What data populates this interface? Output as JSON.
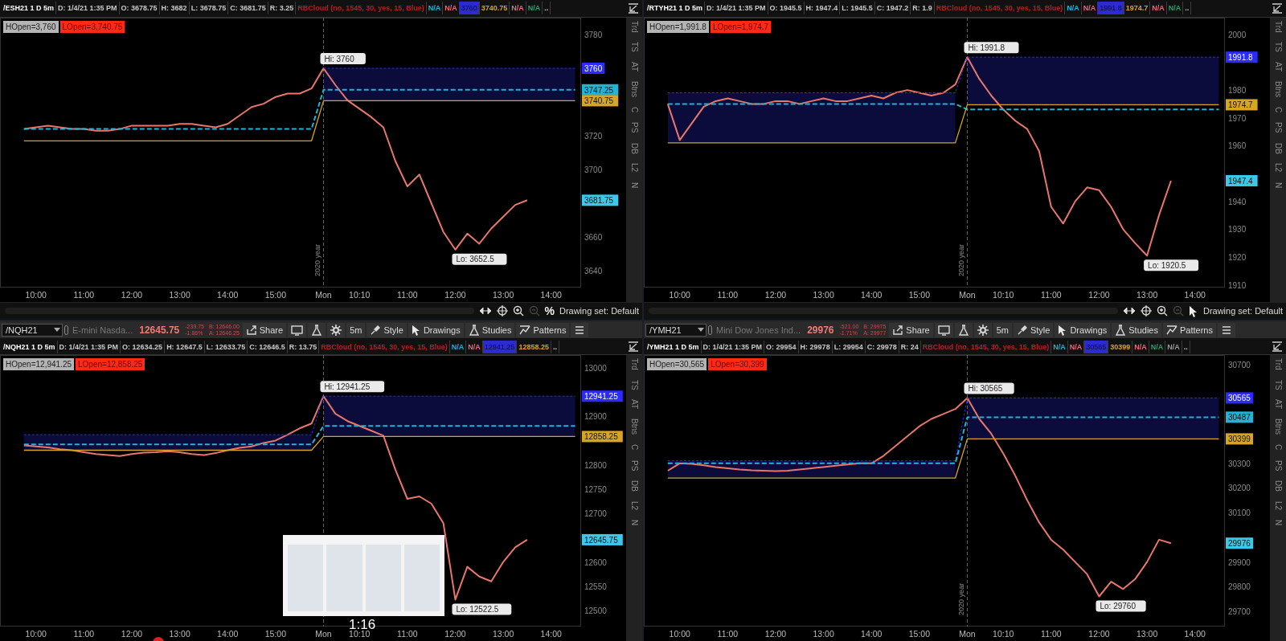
{
  "panels": [
    {
      "header_items": [
        {
          "text": "/ESH21 1 D 5m",
          "color": "#ffffff",
          "kind": "symbol"
        },
        {
          "text": "D: 1/4/21 1:35 PM",
          "color": "#c8c8c8",
          "kind": "plain"
        },
        {
          "text": "O: 3678.75",
          "color": "#c8c8c8",
          "kind": "plain"
        },
        {
          "text": "H: 3682",
          "color": "#c8c8c8",
          "kind": "plain"
        },
        {
          "text": "L: 3678.75",
          "color": "#c8c8c8",
          "kind": "plain"
        },
        {
          "text": "C: 3681.75",
          "color": "#c8c8c8",
          "kind": "plain"
        },
        {
          "text": "R: 3.25",
          "color": "#c8c8c8",
          "kind": "plain"
        },
        {
          "text": "RBCloud (no, 1545, 30, yes, 15, Blue)",
          "color": "#b02020",
          "kind": "plain"
        },
        {
          "text": "N/A",
          "color": "#1fb4d8",
          "kind": "plain"
        },
        {
          "text": "N/A",
          "color": "#e06c7c",
          "kind": "plain"
        },
        {
          "text": "3760",
          "color": "#2b2bd0",
          "kind": "boxed"
        },
        {
          "text": "3740.75",
          "color": "#d8a521",
          "kind": "plain"
        },
        {
          "text": "N/A",
          "color": "#e06c7c",
          "kind": "plain"
        },
        {
          "text": "N/A",
          "color": "#2e9e6e",
          "kind": "plain"
        },
        {
          "text": "..",
          "kind": "plain"
        }
      ],
      "study_labels": [
        {
          "text": "HOpen=3,760",
          "color": "#b4b4b4"
        },
        {
          "text": "LOpen=3,740.75",
          "color": "#ff2a14"
        }
      ],
      "side_tabs": [
        "Trd",
        "TS",
        "AT",
        "Btns",
        "C",
        "PS",
        "DB",
        "L2",
        "N"
      ],
      "chart_data": {
        "type": "line",
        "ylim": [
          3630,
          3790
        ],
        "categories": [
          null,
          "10:00",
          null,
          null,
          null,
          "11:00",
          null,
          null,
          null,
          "12:00",
          null,
          null,
          null,
          "13:00",
          null,
          null,
          null,
          "14:00",
          null,
          null,
          null,
          "15:00",
          null,
          null,
          null,
          "Mon",
          null,
          null,
          "10:10",
          null,
          null,
          null,
          "11:00",
          null,
          null,
          null,
          "12:00",
          null,
          null,
          null,
          "13:00",
          null,
          null,
          null,
          "14:00",
          null,
          null
        ],
        "series": [
          {
            "color": "#e9766b",
            "values": [
              3724,
              3725,
              3726,
              3725,
              3724,
              3724,
              3723,
              3723,
              3724,
              3726,
              3726,
              3726,
              3726,
              3727,
              3727,
              3726,
              3725,
              3727,
              3732,
              3737,
              3739,
              3743,
              3745,
              3745,
              3748,
              3760,
              3750,
              3741,
              3736,
              3731,
              3725,
              3705,
              3690,
              3697,
              3680,
              3663,
              3652.5,
              3662,
              3656,
              3665,
              3672,
              3679,
              3681.75,
              null,
              null,
              null,
              null
            ]
          },
          {
            "color": "#2b2bff",
            "line_style": "dashed",
            "values": [
              null,
              null,
              null,
              null,
              null,
              null,
              null,
              null,
              null,
              null,
              null,
              null,
              null,
              null,
              null,
              null,
              null,
              null,
              null,
              null,
              null,
              null,
              null,
              null,
              null,
              3760,
              3760,
              3760,
              3760,
              3760,
              3760,
              3760,
              3760,
              3760,
              3760,
              3760,
              3760,
              3760,
              3760,
              3760,
              3760,
              3760,
              3760,
              3760,
              3760,
              3760,
              3760
            ]
          },
          {
            "color": "#1fb4d8",
            "line_style": "dashed",
            "values": [
              3724,
              3724,
              3724,
              3724,
              3724,
              3724,
              3724,
              3724,
              3724,
              3724,
              3724,
              3724,
              3724,
              3724,
              3724,
              3724,
              3724,
              3724,
              3724,
              3724,
              3724,
              3724,
              3724,
              3724,
              3724,
              3747.25,
              3747.25,
              3747.25,
              3747.25,
              3747.25,
              3747.25,
              3747.25,
              3747.25,
              3747.25,
              3747.25,
              3747.25,
              3747.25,
              3747.25,
              3747.25,
              3747.25,
              3747.25,
              3747.25,
              3747.25,
              3747.25,
              3747.25,
              3747.25,
              3747.25
            ]
          },
          {
            "color": "#d8a521",
            "values": [
              3717,
              3717,
              3717,
              3717,
              3717,
              3717,
              3717,
              3717,
              3717,
              3717,
              3717,
              3717,
              3717,
              3717,
              3717,
              3717,
              3717,
              3717,
              3717,
              3717,
              3717,
              3717,
              3717,
              3717,
              3717,
              3740.75,
              3740.75,
              3740.75,
              3740.75,
              3740.75,
              3740.75,
              3740.75,
              3740.75,
              3740.75,
              3740.75,
              3740.75,
              3740.75,
              3740.75,
              3740.75,
              3740.75,
              3740.75,
              3740.75,
              3740.75,
              3740.75,
              3740.75,
              3740.75,
              3740.75
            ]
          }
        ],
        "yticks": [
          3780,
          3720,
          3700,
          3660,
          3640
        ],
        "annotations": [
          {
            "text": "Hi: 3760",
            "x": "Mon",
            "y": 3760
          },
          "Lo: 3652.5"
        ]
      },
      "axis_tags": [
        {
          "text": "3760",
          "color": "#2b2bff"
        },
        {
          "text": "3747.25",
          "color": "#1fb4d8"
        },
        {
          "text": "3740.75",
          "color": "#d8a521"
        },
        {
          "text": "3681.75",
          "color": "#3cc8e8"
        }
      ],
      "year_label": "2020 year",
      "status_bar": {
        "mode": {
          "kind": "text",
          "text": "%"
        },
        "text": "Drawing set: Default"
      }
    },
    {
      "header_items": [
        {
          "text": "/RTYH21 1 D 5m",
          "color": "#ffffff",
          "kind": "symbol"
        },
        {
          "text": "D: 1/4/21 1:35 PM",
          "color": "#c8c8c8",
          "kind": "plain"
        },
        {
          "text": "O: 1945.5",
          "color": "#c8c8c8",
          "kind": "plain"
        },
        {
          "text": "H: 1947.4",
          "color": "#c8c8c8",
          "kind": "plain"
        },
        {
          "text": "L: 1945.5",
          "color": "#c8c8c8",
          "kind": "plain"
        },
        {
          "text": "C: 1947.2",
          "color": "#c8c8c8",
          "kind": "plain"
        },
        {
          "text": "R: 1.9",
          "color": "#c8c8c8",
          "kind": "plain"
        },
        {
          "text": "RBCloud (no, 1545, 30, yes, 15, Blue)",
          "color": "#b02020",
          "kind": "plain"
        },
        {
          "text": "N/A",
          "color": "#1fb4d8",
          "kind": "plain"
        },
        {
          "text": "N/A",
          "color": "#e06c7c",
          "kind": "plain"
        },
        {
          "text": "1991.8",
          "color": "#2b2bd0",
          "kind": "boxed"
        },
        {
          "text": "1974.7",
          "color": "#d8a521",
          "kind": "plain"
        },
        {
          "text": "N/A",
          "color": "#e06c7c",
          "kind": "plain"
        },
        {
          "text": "N/A",
          "color": "#2e9e6e",
          "kind": "plain"
        },
        {
          "text": "..",
          "kind": "plain"
        }
      ],
      "study_labels": [
        {
          "text": "HOpen=1,991.8",
          "color": "#b4b4b4"
        },
        {
          "text": "LOpen=1,974.7",
          "color": "#ff2a14"
        }
      ],
      "side_tabs": [
        "Trd",
        "TS",
        "AT",
        "Btns",
        "C",
        "PS",
        "DB",
        "L2",
        "N"
      ],
      "chart_data": {
        "type": "line",
        "ylim": [
          1909,
          2006
        ],
        "categories": [
          null,
          "10:00",
          null,
          null,
          null,
          "11:00",
          null,
          null,
          null,
          "12:00",
          null,
          null,
          null,
          "13:00",
          null,
          null,
          null,
          "14:00",
          null,
          null,
          null,
          "15:00",
          null,
          null,
          null,
          "Mon",
          null,
          null,
          "10:10",
          null,
          null,
          null,
          "11:00",
          null,
          null,
          null,
          "12:00",
          null,
          null,
          null,
          "13:00",
          null,
          null,
          null,
          "14:00",
          null,
          null
        ],
        "series": [
          {
            "color": "#e9766b",
            "values": [
              1975,
              1962,
              1968,
              1974,
              1976,
              1977,
              1976,
              1975,
              1975,
              1976,
              1976,
              1975,
              1976,
              1977,
              1976,
              1976,
              1977,
              1978,
              1977,
              1979,
              1980,
              1979,
              1978,
              1979,
              1982,
              1991.8,
              1984,
              1978,
              1973,
              1969,
              1966,
              1958,
              1938,
              1932,
              1940,
              1945,
              1944,
              1938,
              1930,
              1925,
              1920.5,
              1935,
              1947.4,
              null,
              null,
              null,
              null
            ]
          },
          {
            "color": "#2b2bff",
            "line_style": "dashed",
            "values": [
              1979,
              1979,
              1979,
              1979,
              1979,
              1979,
              1979,
              1979,
              1979,
              1979,
              1979,
              1979,
              1979,
              1979,
              1979,
              1979,
              1979,
              1979,
              1979,
              1979,
              1979,
              1979,
              1979,
              1979,
              1979,
              1991.8,
              1991.8,
              1991.8,
              1991.8,
              1991.8,
              1991.8,
              1991.8,
              1991.8,
              1991.8,
              1991.8,
              1991.8,
              1991.8,
              1991.8,
              1991.8,
              1991.8,
              1991.8,
              1991.8,
              1991.8,
              1991.8,
              1991.8,
              1991.8,
              1991.8
            ]
          },
          {
            "color": "#1fb4d8",
            "line_style": "dashed",
            "values": [
              1975,
              1975,
              1975,
              1975,
              1975,
              1975,
              1975,
              1975,
              1975,
              1975,
              1975,
              1975,
              1975,
              1975,
              1975,
              1975,
              1975,
              1975,
              1975,
              1975,
              1975,
              1975,
              1975,
              1975,
              1975,
              1973,
              1973,
              1973,
              1973,
              1973,
              1973,
              1973,
              1973,
              1973,
              1973,
              1973,
              1973,
              1973,
              1973,
              1973,
              1973,
              1973,
              1973,
              1973,
              1973,
              1973,
              1973
            ]
          },
          {
            "color": "#d8a521",
            "values": [
              1961,
              1961,
              1961,
              1961,
              1961,
              1961,
              1961,
              1961,
              1961,
              1961,
              1961,
              1961,
              1961,
              1961,
              1961,
              1961,
              1961,
              1961,
              1961,
              1961,
              1961,
              1961,
              1961,
              1961,
              1961,
              1974.7,
              1974.7,
              1974.7,
              1974.7,
              1974.7,
              1974.7,
              1974.7,
              1974.7,
              1974.7,
              1974.7,
              1974.7,
              1974.7,
              1974.7,
              1974.7,
              1974.7,
              1974.7,
              1974.7,
              1974.7,
              1974.7,
              1974.7,
              1974.7,
              1974.7
            ]
          }
        ],
        "yticks": [
          2000,
          1980,
          1970,
          1960,
          1940,
          1930,
          1920,
          1910
        ],
        "annotations": [
          {
            "text": "Hi: 1991.8",
            "x": "Mon",
            "y": 1991.8
          },
          "Lo: 1920.5"
        ]
      },
      "axis_tags": [
        {
          "text": "1991.8",
          "color": "#2b2bff"
        },
        {
          "text": "1974.7",
          "color": "#d8a521"
        },
        {
          "text": "1947.4",
          "color": "#3cc8e8"
        }
      ],
      "year_label": "2020 year",
      "status_bar": {
        "mode": {
          "kind": "pointer"
        },
        "text": "Drawing set: Default"
      }
    },
    {
      "toolbar": {
        "symbol": "/NQH21",
        "description": "E-mini Nasda...",
        "last": "12645.75",
        "change": "-239.75",
        "change_pct": "-1.86%",
        "bid": "B: 12646.00",
        "ask": "A: 12646.25",
        "buttons": [
          {
            "kind": "share",
            "label": "Share"
          },
          {
            "kind": "monitor"
          },
          {
            "kind": "flask"
          },
          {
            "kind": "gear"
          },
          {
            "kind": "interval",
            "label": "5m"
          },
          {
            "kind": "style",
            "label": "Style"
          },
          {
            "kind": "drawings",
            "label": "Drawings"
          },
          {
            "kind": "studies",
            "label": "Studies"
          },
          {
            "kind": "patterns",
            "label": "Patterns"
          },
          {
            "kind": "menu"
          }
        ]
      },
      "header_items": [
        {
          "text": "/NQH21 1 D 5m",
          "color": "#ffffff",
          "kind": "symbol"
        },
        {
          "text": "D: 1/4/21 1:35 PM",
          "color": "#c8c8c8",
          "kind": "plain"
        },
        {
          "text": "O: 12634.25",
          "color": "#c8c8c8",
          "kind": "plain"
        },
        {
          "text": "H: 12647.5",
          "color": "#c8c8c8",
          "kind": "plain"
        },
        {
          "text": "L: 12633.75",
          "color": "#c8c8c8",
          "kind": "plain"
        },
        {
          "text": "C: 12646.5",
          "color": "#c8c8c8",
          "kind": "plain"
        },
        {
          "text": "R: 13.75",
          "color": "#c8c8c8",
          "kind": "plain"
        },
        {
          "text": "RBCloud (no, 1545, 30, yes, 15, Blue)",
          "color": "#b02020",
          "kind": "plain"
        },
        {
          "text": "N/A",
          "color": "#1fb4d8",
          "kind": "plain"
        },
        {
          "text": "N/A",
          "color": "#e06c7c",
          "kind": "plain"
        },
        {
          "text": "12941.25",
          "color": "#2b2bd0",
          "kind": "boxed"
        },
        {
          "text": "12858.25",
          "color": "#d8a521",
          "kind": "plain"
        },
        {
          "text": "..",
          "kind": "plain"
        }
      ],
      "study_labels": [
        {
          "text": "HOpen=12,941.25",
          "color": "#b4b4b4"
        },
        {
          "text": "LOpen=12,858.25",
          "color": "#ff2a14"
        }
      ],
      "side_tabs": [
        "Trd",
        "TS",
        "AT",
        "Btns",
        "C",
        "PS",
        "DB",
        "L2",
        "N"
      ],
      "chart_data": {
        "type": "line",
        "ylim": [
          12467,
          13026
        ],
        "categories": [
          null,
          "10:00",
          null,
          null,
          null,
          "11:00",
          null,
          null,
          null,
          "12:00",
          null,
          null,
          null,
          "13:00",
          null,
          null,
          null,
          "14:00",
          null,
          null,
          null,
          "15:00",
          null,
          null,
          null,
          "Mon",
          null,
          null,
          "10:10",
          null,
          null,
          null,
          "11:00",
          null,
          null,
          null,
          "12:00",
          null,
          null,
          null,
          "13:00",
          null,
          null,
          null,
          "14:00",
          null,
          null
        ],
        "series": [
          {
            "color": "#e9766b",
            "values": [
              12840,
              12838,
              12836,
              12832,
              12830,
              12826,
              12822,
              12820,
              12818,
              12822,
              12825,
              12826,
              12828,
              12826,
              12822,
              12820,
              12824,
              12830,
              12835,
              12838,
              12845,
              12850,
              12862,
              12875,
              12885,
              12941.25,
              12905,
              12890,
              12880,
              12870,
              12860,
              12790,
              12730,
              12735,
              12720,
              12680,
              12522.5,
              12590,
              12570,
              12560,
              12600,
              12630,
              12645.75,
              null,
              null,
              null,
              null
            ]
          },
          {
            "color": "#2b2bff",
            "line_style": "dashed",
            "values": [
              12862,
              12862,
              12862,
              12862,
              12862,
              12862,
              12862,
              12862,
              12862,
              12862,
              12862,
              12862,
              12862,
              12862,
              12862,
              12862,
              12862,
              12862,
              12862,
              12862,
              12862,
              12862,
              12862,
              12862,
              12862,
              12941.25,
              12941.25,
              12941.25,
              12941.25,
              12941.25,
              12941.25,
              12941.25,
              12941.25,
              12941.25,
              12941.25,
              12941.25,
              12941.25,
              12941.25,
              12941.25,
              12941.25,
              12941.25,
              12941.25,
              12941.25,
              12941.25,
              12941.25,
              12941.25,
              12941.25
            ]
          },
          {
            "color": "#1fb4d8",
            "line_style": "dashed",
            "values": [
              12842,
              12842,
              12842,
              12842,
              12842,
              12842,
              12842,
              12842,
              12842,
              12842,
              12842,
              12842,
              12842,
              12842,
              12842,
              12842,
              12842,
              12842,
              12842,
              12842,
              12842,
              12842,
              12842,
              12842,
              12842,
              12880,
              12880,
              12880,
              12880,
              12880,
              12880,
              12880,
              12880,
              12880,
              12880,
              12880,
              12880,
              12880,
              12880,
              12880,
              12880,
              12880,
              12880,
              12880,
              12880,
              12880,
              12880
            ]
          },
          {
            "color": "#d8a521",
            "values": [
              12830,
              12830,
              12830,
              12830,
              12830,
              12830,
              12830,
              12830,
              12830,
              12830,
              12830,
              12830,
              12830,
              12830,
              12830,
              12830,
              12830,
              12830,
              12830,
              12830,
              12830,
              12830,
              12830,
              12830,
              12830,
              12858.25,
              12858.25,
              12858.25,
              12858.25,
              12858.25,
              12858.25,
              12858.25,
              12858.25,
              12858.25,
              12858.25,
              12858.25,
              12858.25,
              12858.25,
              12858.25,
              12858.25,
              12858.25,
              12858.25,
              12858.25,
              12858.25,
              12858.25,
              12858.25,
              12858.25
            ]
          }
        ],
        "yticks": [
          13000,
          12900,
          12800,
          12750,
          12700,
          12600,
          12550,
          12500
        ],
        "annotations": [
          {
            "text": "Hi: 12941.25",
            "x": "Mon",
            "y": 12941.25
          },
          "Lo: 12522.5"
        ]
      },
      "axis_tags": [
        {
          "text": "12941.25",
          "color": "#2b2bff"
        },
        {
          "text": "12858.25",
          "color": "#d8a521"
        },
        {
          "text": "12645.75",
          "color": "#3cc8e8"
        }
      ]
    },
    {
      "toolbar": {
        "symbol": "/YMH21",
        "description": "Mini Dow Jones Ind...",
        "last": "29976",
        "change": "-521.00",
        "change_pct": "-1.71%",
        "bid": "B: 29975",
        "ask": "A: 29977",
        "buttons": [
          {
            "kind": "share",
            "label": "Share"
          },
          {
            "kind": "monitor"
          },
          {
            "kind": "flask"
          },
          {
            "kind": "gear"
          },
          {
            "kind": "interval",
            "label": "5m"
          },
          {
            "kind": "style",
            "label": "Style"
          },
          {
            "kind": "drawings",
            "label": "Drawings"
          },
          {
            "kind": "studies",
            "label": "Studies"
          },
          {
            "kind": "patterns",
            "label": "Patterns"
          },
          {
            "kind": "menu"
          }
        ]
      },
      "header_items": [
        {
          "text": "/YMH21 1 D 5m",
          "color": "#ffffff",
          "kind": "symbol"
        },
        {
          "text": "D: 1/4/21 1:35 PM",
          "color": "#c8c8c8",
          "kind": "plain"
        },
        {
          "text": "O: 29954",
          "color": "#c8c8c8",
          "kind": "plain"
        },
        {
          "text": "H: 29978",
          "color": "#c8c8c8",
          "kind": "plain"
        },
        {
          "text": "L: 29954",
          "color": "#c8c8c8",
          "kind": "plain"
        },
        {
          "text": "C: 29978",
          "color": "#c8c8c8",
          "kind": "plain"
        },
        {
          "text": "R: 24",
          "color": "#c8c8c8",
          "kind": "plain"
        },
        {
          "text": "RBCloud (no, 1545, 30, yes, 15, Blue)",
          "color": "#b02020",
          "kind": "plain"
        },
        {
          "text": "N/A",
          "color": "#1fb4d8",
          "kind": "plain"
        },
        {
          "text": "N/A",
          "color": "#e06c7c",
          "kind": "plain"
        },
        {
          "text": "30565",
          "color": "#2b2bd0",
          "kind": "boxed"
        },
        {
          "text": "30399",
          "color": "#d8a521",
          "kind": "plain"
        },
        {
          "text": "N/A",
          "color": "#e06c7c",
          "kind": "plain"
        },
        {
          "text": "N/A",
          "color": "#2e9e6e",
          "kind": "plain"
        },
        {
          "text": "N/A",
          "color": "#9a9a9a",
          "kind": "plain"
        },
        {
          "text": "..",
          "kind": "plain"
        }
      ],
      "study_labels": [
        {
          "text": "HOpen=30,565",
          "color": "#b4b4b4"
        },
        {
          "text": "LOpen=30,399",
          "color": "#ff2a14"
        }
      ],
      "side_tabs": [
        "Trd",
        "TS",
        "AT",
        "Btns",
        "C",
        "PS",
        "DB",
        "L2",
        "N"
      ],
      "chart_data": {
        "type": "line",
        "ylim": [
          29638,
          30739
        ],
        "categories": [
          null,
          "10:00",
          null,
          null,
          null,
          "11:00",
          null,
          null,
          null,
          "12:00",
          null,
          null,
          null,
          "13:00",
          null,
          null,
          null,
          "14:00",
          null,
          null,
          null,
          "15:00",
          null,
          null,
          null,
          "Mon",
          null,
          null,
          "10:10",
          null,
          null,
          null,
          "11:00",
          null,
          null,
          null,
          "12:00",
          null,
          null,
          null,
          "13:00",
          null,
          null,
          null,
          "14:00",
          null,
          null
        ],
        "series": [
          {
            "color": "#e9766b",
            "values": [
              30270,
              30300,
              30298,
              30292,
              30285,
              30280,
              30275,
              30272,
              30270,
              30268,
              30270,
              30275,
              30280,
              30285,
              30290,
              30295,
              30300,
              30300,
              30330,
              30370,
              30410,
              30450,
              30480,
              30500,
              30520,
              30565,
              30480,
              30420,
              30340,
              30250,
              30150,
              30060,
              29990,
              29950,
              29900,
              29850,
              29760,
              29820,
              29790,
              29830,
              29900,
              29990,
              29976,
              null,
              null,
              null,
              null
            ]
          },
          {
            "color": "#2b2bff",
            "line_style": "dashed",
            "values": [
              30310,
              30310,
              30310,
              30310,
              30310,
              30310,
              30310,
              30310,
              30310,
              30310,
              30310,
              30310,
              30310,
              30310,
              30310,
              30310,
              30310,
              30310,
              30310,
              30310,
              30310,
              30310,
              30310,
              30310,
              30310,
              30565,
              30565,
              30565,
              30565,
              30565,
              30565,
              30565,
              30565,
              30565,
              30565,
              30565,
              30565,
              30565,
              30565,
              30565,
              30565,
              30565,
              30565,
              30565,
              30565,
              30565,
              30565
            ]
          },
          {
            "color": "#1fb4d8",
            "line_style": "dashed",
            "values": [
              30300,
              30300,
              30300,
              30300,
              30300,
              30300,
              30300,
              30300,
              30300,
              30300,
              30300,
              30300,
              30300,
              30300,
              30300,
              30300,
              30300,
              30300,
              30300,
              30300,
              30300,
              30300,
              30300,
              30300,
              30300,
              30487,
              30487,
              30487,
              30487,
              30487,
              30487,
              30487,
              30487,
              30487,
              30487,
              30487,
              30487,
              30487,
              30487,
              30487,
              30487,
              30487,
              30487,
              30487,
              30487,
              30487,
              30487
            ]
          },
          {
            "color": "#d8a521",
            "values": [
              30240,
              30240,
              30240,
              30240,
              30240,
              30240,
              30240,
              30240,
              30240,
              30240,
              30240,
              30240,
              30240,
              30240,
              30240,
              30240,
              30240,
              30240,
              30240,
              30240,
              30240,
              30240,
              30240,
              30240,
              30240,
              30399,
              30399,
              30399,
              30399,
              30399,
              30399,
              30399,
              30399,
              30399,
              30399,
              30399,
              30399,
              30399,
              30399,
              30399,
              30399,
              30399,
              30399,
              30399,
              30399,
              30399,
              30399
            ]
          }
        ],
        "yticks": [
          30700,
          30300,
          30200,
          30100,
          29900,
          29800,
          29700
        ],
        "annotations": [
          {
            "text": "Hi: 30565",
            "x": "Mon",
            "y": 30565
          },
          "Lo: 29760"
        ]
      },
      "axis_tags": [
        {
          "text": "30565",
          "color": "#2b2bff"
        },
        {
          "text": "30487",
          "color": "#1fb4d8"
        },
        {
          "text": "30399",
          "color": "#d8a521"
        },
        {
          "text": "29976",
          "color": "#3cc8e8"
        }
      ],
      "year_label": "2020 year"
    }
  ],
  "video_overlay": {
    "time": "1:16"
  }
}
